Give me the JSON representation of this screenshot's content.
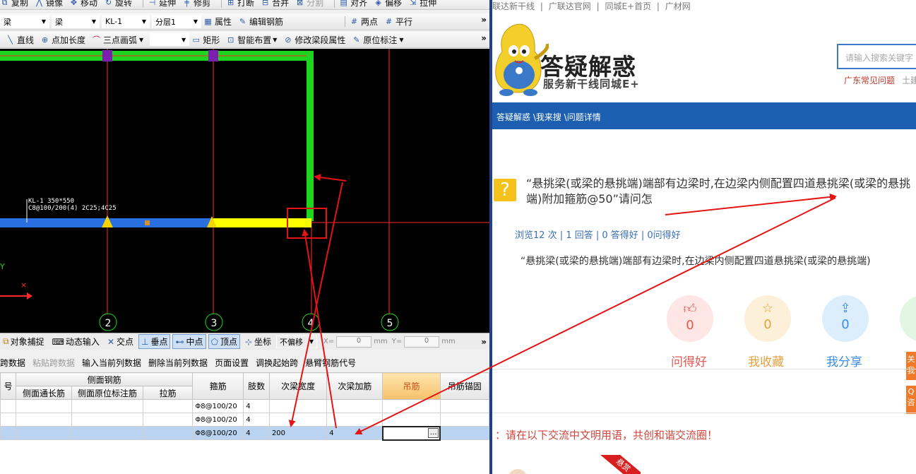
{
  "cad": {
    "toolbar1": {
      "items": [
        "复制",
        "镜像",
        "移动",
        "旋转",
        "延伸",
        "修剪",
        "打断",
        "合并",
        "分割",
        "对齐",
        "偏移",
        "拉伸"
      ]
    },
    "toolbar2": {
      "type1": "梁",
      "type2": "梁",
      "element": "KL-1",
      "layer": "分层1",
      "property": "属性",
      "edit_rebar": "编辑钢筋",
      "two_points": "两点",
      "parallel": "平行"
    },
    "toolbar3": {
      "line": "直线",
      "point_length": "点加长度",
      "arc": "三点画弧",
      "rect": "矩形",
      "smart_layout": "智能布置",
      "modify_span": "修改梁段属性",
      "origin_mark": "原位标注"
    },
    "drawing": {
      "beam_label": "KL-1 350*550",
      "beam_rebar": "C8@100/200(4) 2C25;4C25",
      "axes": [
        "2",
        "3",
        "4",
        "5"
      ],
      "y_axis": "Y"
    },
    "snapbar": {
      "object_snap": "对象捕捉",
      "dynamic_input": "动态输入",
      "intersection": "交点",
      "perpendicular": "垂点",
      "midpoint": "中点",
      "vertex": "顶点",
      "coordinate": "坐标",
      "offset_mode": "不偏移",
      "x_label": "X=",
      "x_value": "0",
      "y_label": "Y=",
      "y_value": "0",
      "unit": "mm"
    },
    "tablebar": [
      "跨数据",
      "粘贴跨数据",
      "输入当前列数据",
      "删除当前列数据",
      "页面设置",
      "调换起始跨",
      "悬臂钢筋代号"
    ],
    "table": {
      "group_header": "侧面钢筋",
      "headers": [
        "号",
        "侧面通长筋",
        "侧面原位标注筋",
        "拉筋",
        "箍筋",
        "肢数",
        "次梁宽度",
        "次梁加筋",
        "吊筋",
        "吊筋锚固"
      ],
      "rows": [
        {
          "stirrup": "Φ8@100/20",
          "legs": "4",
          "width": "",
          "add": ""
        },
        {
          "stirrup": "Φ8@100/20",
          "legs": "4",
          "width": "",
          "add": ""
        },
        {
          "stirrup": "Φ8@100/20",
          "legs": "4",
          "width": "200",
          "add": "4"
        }
      ],
      "ellipsis": "…"
    }
  },
  "web": {
    "topnav": [
      "联达新干线",
      "|",
      "广联达官网",
      "|",
      "同城E+首页",
      "|",
      "广材网"
    ],
    "brand_title": "答疑解惑",
    "brand_sub": "服务新干线同城E+",
    "search_placeholder": "请输入搜索关键字",
    "hot_link": "广东常见问题",
    "hot_link2": "土建",
    "breadcrumb": "答疑解惑 \\我来搜 \\问题详情",
    "question_title": "“悬挑梁(或梁的悬挑端)端部有边梁时,在边梁内侧配置四道悬挑梁(或梁的悬挑端)附加箍筋@50”请问怎",
    "stats": "浏览12 次 | 1 回答 | 0 答得好 | 0问得好",
    "question_body": "“悬挑梁(或梁的悬挑端)端部有边梁时,在边梁内侧配置四道悬挑梁(或梁的悬挑端)",
    "actions": [
      {
        "count": "0",
        "label": "问得好",
        "color": "#e05a52"
      },
      {
        "count": "0",
        "label": "我收藏",
        "color": "#e6a23c"
      },
      {
        "count": "0",
        "label": "我分享",
        "color": "#3a8ee6"
      }
    ],
    "notice": "：请在以下交流中文明用语，共创和谐交流圈！",
    "side_btn1": "关",
    "side_btn2": "我",
    "side_btn3": "Q",
    "side_btn4": "咨",
    "ribbon": "悬赏"
  }
}
